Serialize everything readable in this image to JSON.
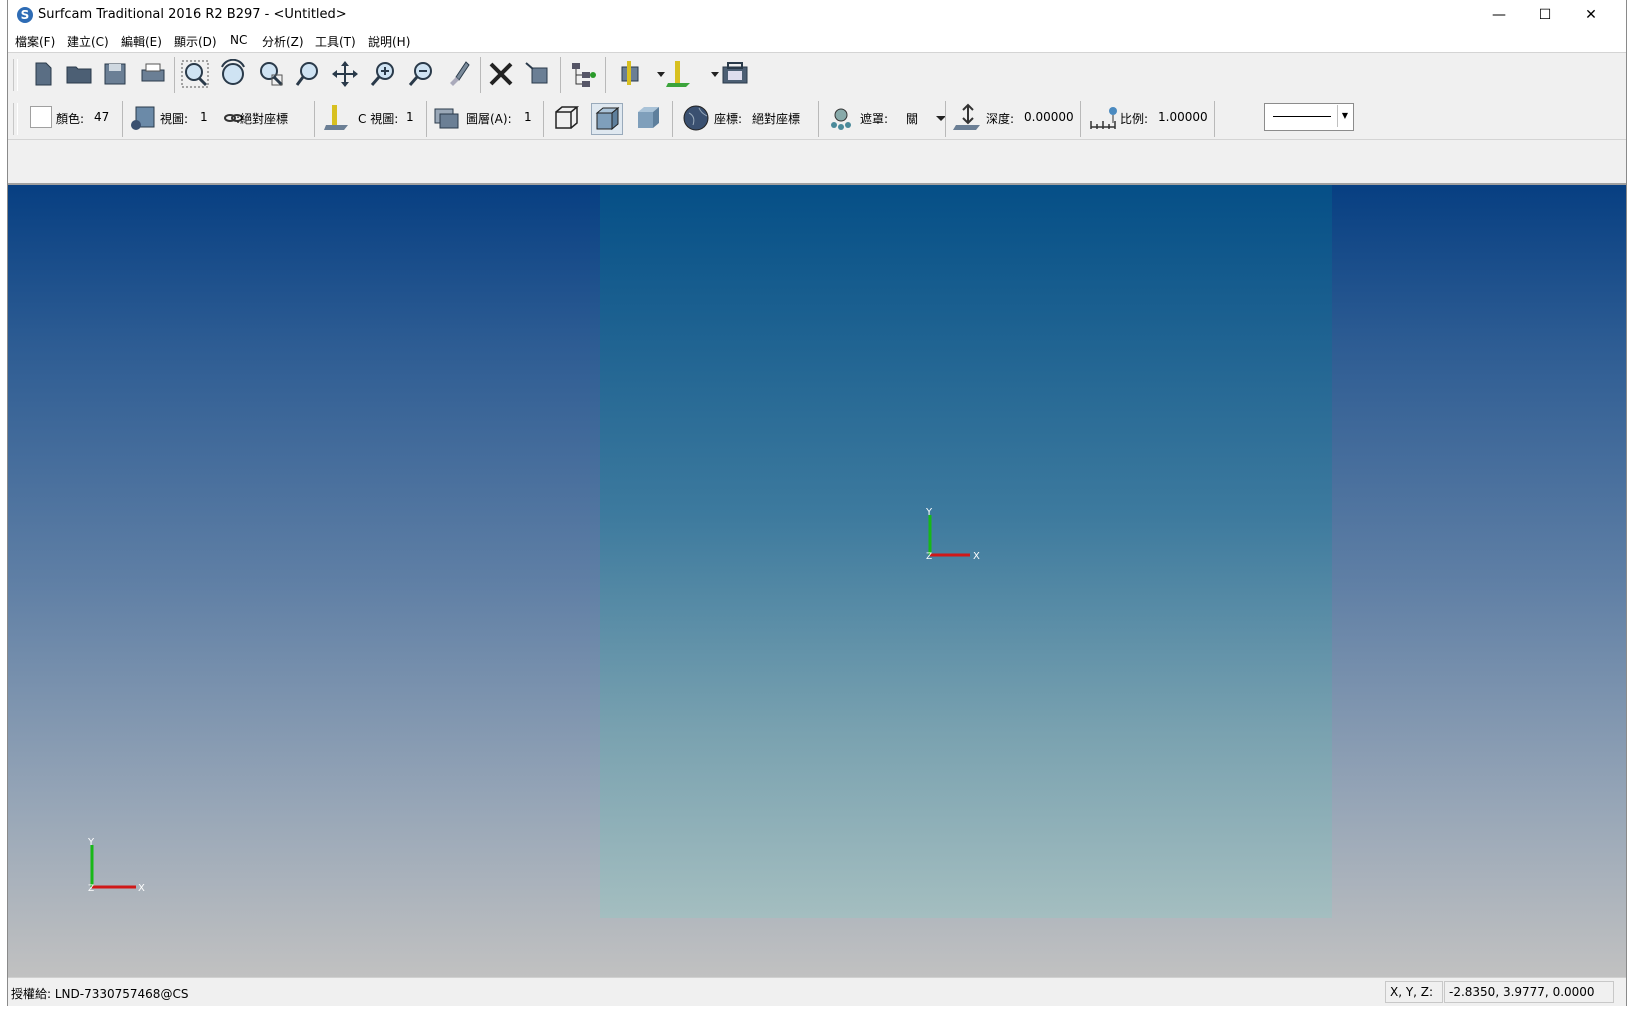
{
  "window": {
    "title": "Surfcam Traditional 2016 R2  B297 - <Untitled>",
    "app_icon": "S",
    "minimize_glyph": "—",
    "maximize_glyph": "☐",
    "close_glyph": "✕"
  },
  "menu": [
    "檔案(F)",
    "建立(C)",
    "編輯(E)",
    "顯示(D)",
    "NC",
    "分析(Z)",
    "工具(T)",
    "說明(H)"
  ],
  "toolbar2": {
    "color_label": "顏色:",
    "color_value": "47",
    "view_label": "視圖:",
    "view_value": "1",
    "coord_label": ":絕對座標",
    "cview_label": "C 視圖:",
    "cview_value": "1",
    "layer_label": "圖層(A):",
    "layer_value": "1",
    "coordsys_label": "座標:",
    "coordsys_value": "絕對座標",
    "mask_label": "遮罩:",
    "mask_value": "關",
    "depth_label": "深度:",
    "depth_value": "0.00000",
    "scale_label": "比例:",
    "scale_value": "1.00000"
  },
  "viewport": {
    "axis_x": "X",
    "axis_y": "Y",
    "axis_z": "Z"
  },
  "status": {
    "license": "授權給:  LND-7330757468@CS",
    "xyz_label": "X, Y, Z:",
    "xyz_value": "-2.8350, 3.9777, 0.0000"
  },
  "colors": {
    "viewport_top": "#073f82",
    "viewport_bottom": "#c1c1c1",
    "axis_x": "#d01818",
    "axis_y": "#18b818"
  }
}
